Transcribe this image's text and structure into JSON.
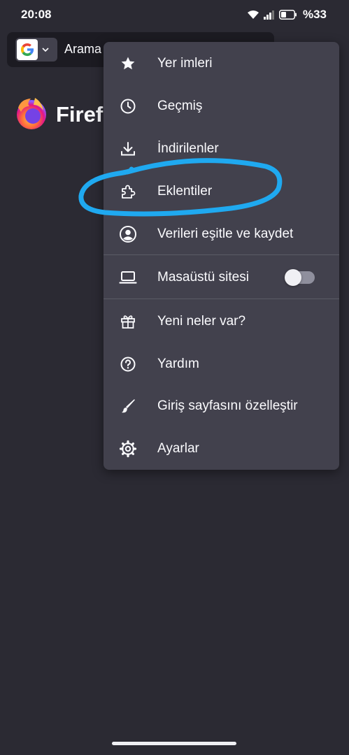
{
  "status_bar": {
    "time": "20:08",
    "battery_text": "%33",
    "icons": [
      "wifi-icon",
      "signal-icon",
      "battery-icon"
    ]
  },
  "toolbar": {
    "search_engine_icon": "google-icon",
    "url_text": "Arama y"
  },
  "homepage": {
    "logo_icon": "firefox-logo",
    "logo_text": "Firefo"
  },
  "menu": {
    "items": [
      {
        "label": "Yer imleri",
        "icon": "star-icon"
      },
      {
        "label": "Geçmiş",
        "icon": "clock-icon"
      },
      {
        "label": "İndirilenler",
        "icon": "download-icon"
      },
      {
        "label": "Eklentiler",
        "icon": "puzzle-icon"
      },
      {
        "label": "Verileri eşitle ve kaydet",
        "icon": "account-icon"
      },
      {
        "label": "Masaüstü sitesi",
        "icon": "laptop-icon",
        "toggle_on": false
      },
      {
        "label": "Yeni neler var?",
        "icon": "gift-icon"
      },
      {
        "label": "Yardım",
        "icon": "help-icon"
      },
      {
        "label": "Giriş sayfasını özelleştir",
        "icon": "brush-icon"
      },
      {
        "label": "Ayarlar",
        "icon": "gear-icon"
      }
    ]
  },
  "colors": {
    "background": "#2b2a33",
    "menu_background": "#42414d",
    "annotation": "#1fa9f0",
    "text": "#fbfbfe"
  }
}
